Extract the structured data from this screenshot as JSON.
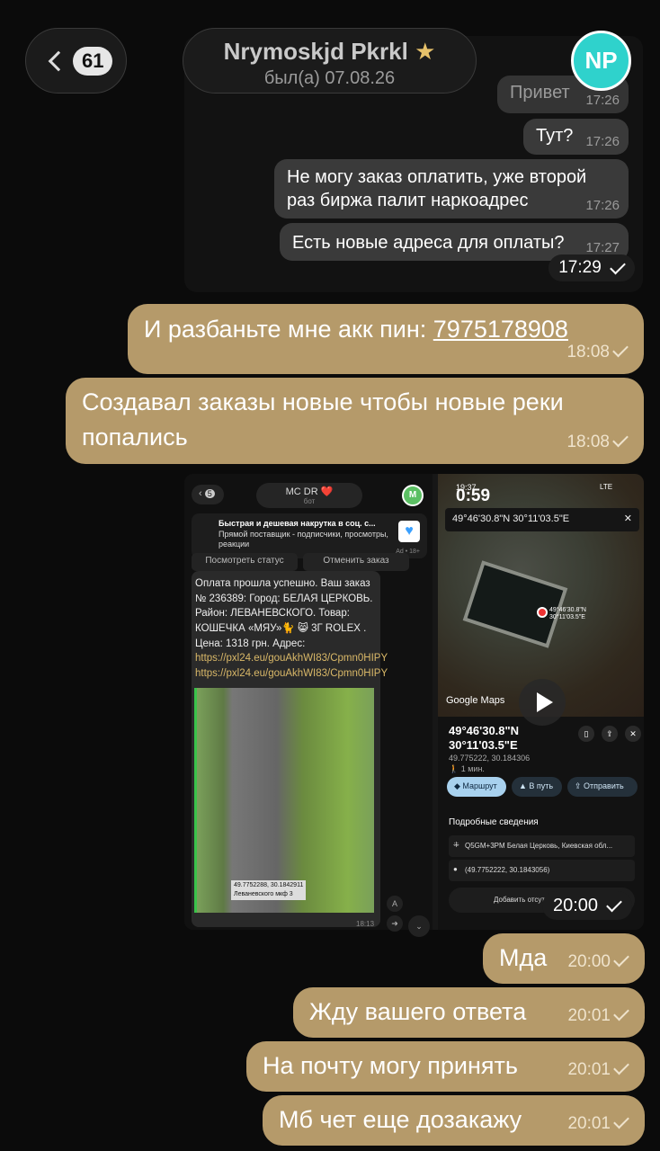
{
  "header": {
    "back_count": "61",
    "contact_name": "Nrymoskjd Pkrkl",
    "contact_star": "★",
    "last_seen": "был(а) 07.08.26",
    "avatar_initials": "NP",
    "avatar_color": "#2fd2cc"
  },
  "forwarded_chat": {
    "messages": [
      {
        "text": "Привет",
        "time": "17:26"
      },
      {
        "text": "Тут?",
        "time": "17:26"
      },
      {
        "text": "Не могу заказ оплатить, уже второй раз биржа палит наркоадрес",
        "time": "17:26"
      },
      {
        "text": "Есть новые адреса для оплаты?",
        "time": "17:27"
      }
    ],
    "time": "17:29"
  },
  "messages": [
    {
      "text": "И разбаньте мне акк пин: ",
      "link": "7975178908",
      "time": "18:08"
    },
    {
      "text": "Создавал заказы новые чтобы новые реки попались",
      "time": "18:08"
    }
  ],
  "media": {
    "left": {
      "back_count": "5",
      "bot_name": "MC DR ❤️",
      "bot_label": "бот",
      "bot_avatar": "M",
      "ad_title": "Быстрая и дешевая накрутка в соц. с...",
      "ad_text": "Прямой поставщик - подписчики, просмотры, реакции",
      "ad_label": "Ad • 18+",
      "btn_status": "Посмотреть статус",
      "btn_cancel": "Отменить заказ",
      "payment_text": "Оплата прошла успешно. Ваш заказ № 236389: Город: БЕЛАЯ ЦЕРКОВЬ. Район: ЛЕВАНЕВСКОГО. Товар: КОШЕЧКА «МЯУ»🐈 😸 3Г ROLEX . Цена: 1318 грн. Адрес: ",
      "link1": "https://pxl24.eu/gouAkhWI83/Cpmn0HIPY",
      "link2": "https://pxl24.eu/gouAkhWI83/Cpmn0HIPY",
      "photo_caption": "49.7752288, 30.1842911",
      "photo_caption2": "Леваневского мкф 3",
      "msg_time": "18:13"
    },
    "right": {
      "video_time": "0:59",
      "status_time": "19:37",
      "status_icons": "LTE",
      "search_value": "49°46'30.8\"N 30°11'03.5\"E",
      "pin_label": "49°46'30.8\"N 30°11'03.5\"E",
      "brand": "Google Maps",
      "coord_line1": "49°46'30.8\"N",
      "coord_line2": "30°11'03.5\"E",
      "decimal": "49.775222, 30.184306",
      "walk": "1 мин.",
      "btn_route": "Маршрут",
      "btn_go": "В путь",
      "btn_send": "Отправить",
      "details_title": "Подробные сведения",
      "detail_plus": "Q5GM+3PM Белая Церковь, Киевская обл...",
      "detail_coords": "(49.7752222, 30.1843056)",
      "add_label": "Добавить отсутст..."
    },
    "time": "20:00"
  },
  "short_messages": [
    {
      "text": "Мда",
      "time": "20:00"
    },
    {
      "text": "Жду вашего ответа",
      "time": "20:01"
    },
    {
      "text": "На почту могу принять",
      "time": "20:01"
    },
    {
      "text": "Мб чет еще дозакажу",
      "time": "20:01"
    }
  ]
}
